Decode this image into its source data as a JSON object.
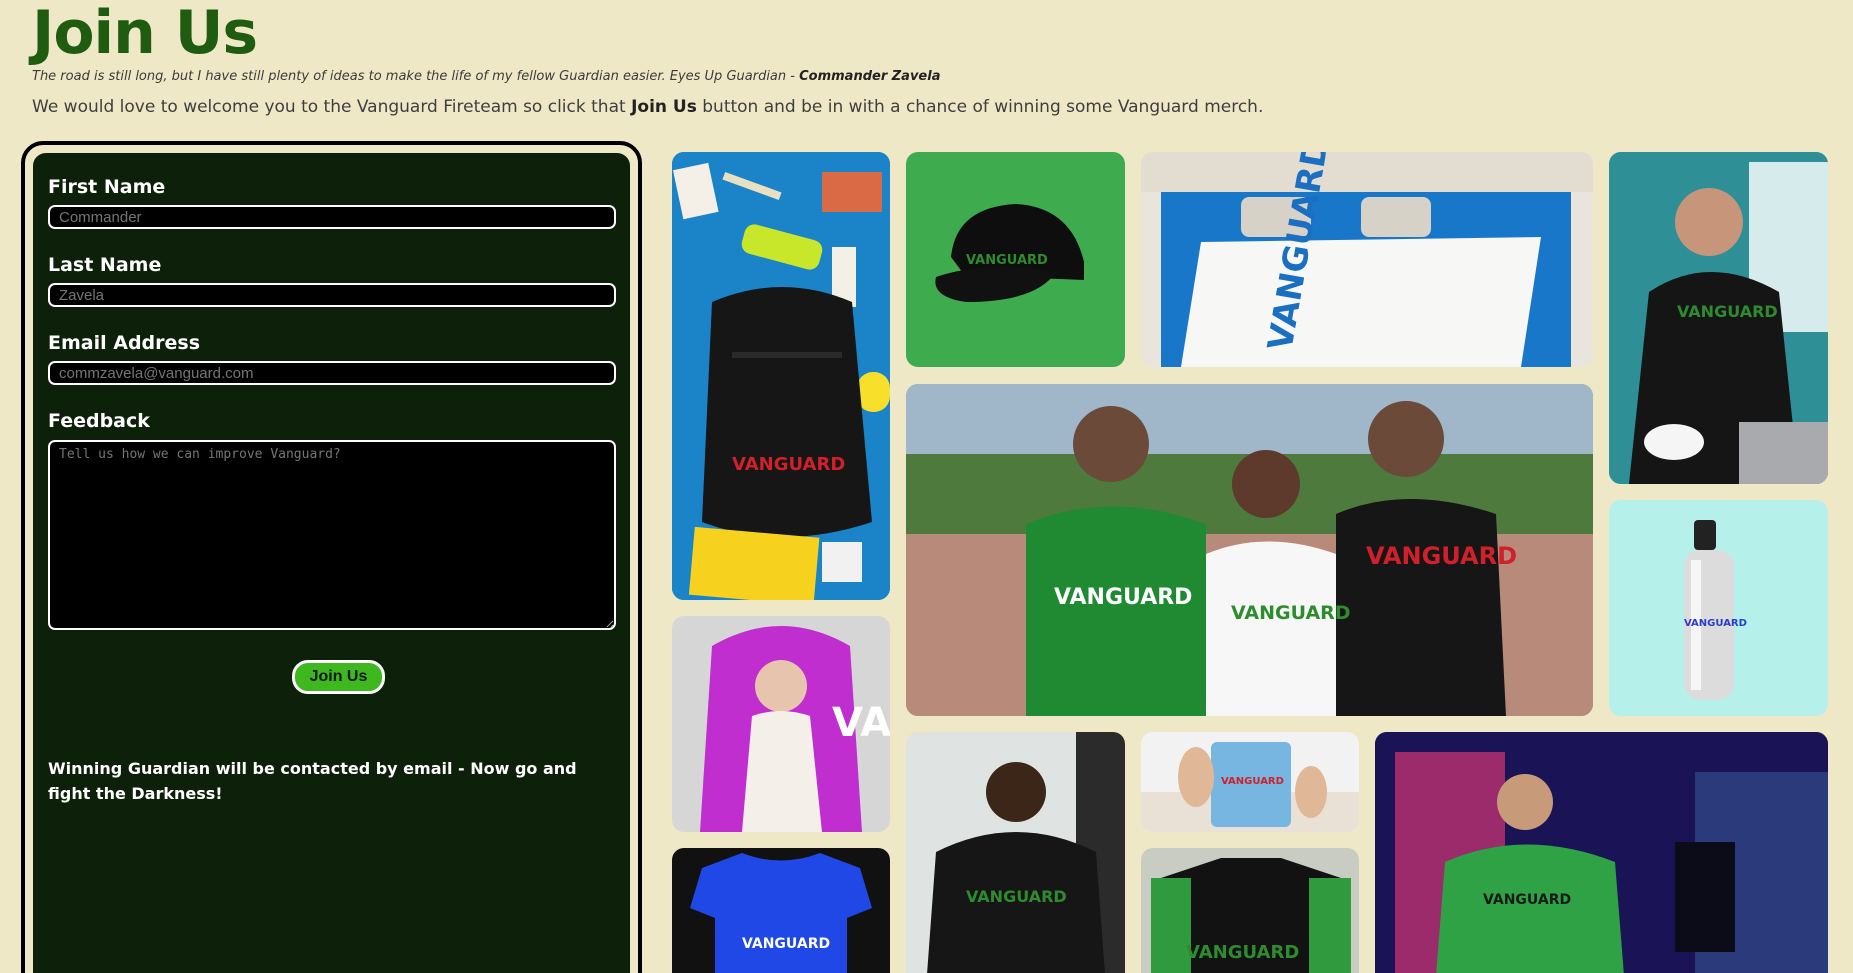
{
  "header": {
    "title": "Join Us",
    "quote_text": "The road is still long, but I have still plenty of ideas to make the life of my fellow Guardian easier. Eyes Up Guardian - ",
    "quote_author": "Commander Zavela",
    "intro_before": "We would love to welcome you to the Vanguard Fireteam so click that ",
    "intro_bold": "Join Us",
    "intro_after": " button and be in with a chance of winning some Vanguard merch."
  },
  "form": {
    "first_name_label": "First Name",
    "first_name_placeholder": "Commander",
    "last_name_label": "Last Name",
    "last_name_placeholder": "Zavela",
    "email_label": "Email Address",
    "email_placeholder": "commzavela@vanguard.com",
    "feedback_label": "Feedback",
    "feedback_placeholder": "Tell us how we can improve Vanguard?",
    "submit_label": "Join Us",
    "winner_note": "Winning Guardian will be contacted by email - Now go and fight the Darkness!"
  },
  "gallery": {
    "brand": "VANGUARD",
    "items": [
      "backpack",
      "snapback-cap",
      "blanket",
      "hoodie-woman",
      "family-tshirts",
      "water-bottle",
      "hooded-blanket",
      "tshirt-blue",
      "sweatshirt-man",
      "mug",
      "varsity-jacket",
      "gamer-tshirt"
    ]
  },
  "colors": {
    "background": "#efe8c6",
    "title_green": "#1f5c0f",
    "panel": "#0d200a",
    "button": "#3fb71f",
    "brand_red": "#d0202a",
    "brand_green": "#2e8b2e"
  }
}
